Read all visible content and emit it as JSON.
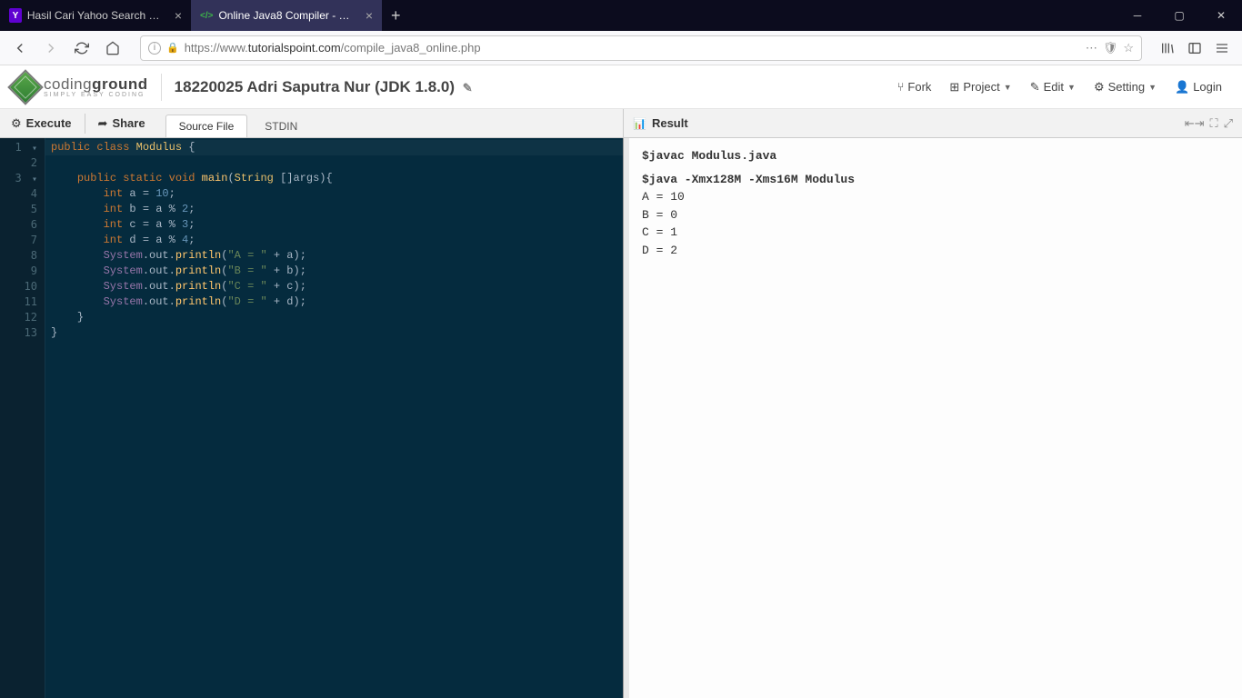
{
  "browser": {
    "tabs": [
      {
        "title": "Hasil Cari Yahoo Search Results",
        "favicon": "Y",
        "favcolor": "#5f01d1"
      },
      {
        "title": "Online Java8 Compiler - Online",
        "favicon": "</>",
        "favcolor": "#3cb44a"
      }
    ],
    "url_prefix": "https://www.",
    "url_domain": "tutorialspoint.com",
    "url_path": "/compile_java8_online.php"
  },
  "logo": {
    "main": "coding",
    "bold": "ground",
    "sub": "SIMPLY EASY CODING"
  },
  "project_title": "18220025 Adri Saputra Nur (JDK 1.8.0)",
  "header_menu": {
    "fork": "Fork",
    "project": "Project",
    "edit": "Edit",
    "setting": "Setting",
    "login": "Login"
  },
  "toolbar": {
    "execute": "Execute",
    "share": "Share",
    "source": "Source File",
    "stdin": "STDIN",
    "result": "Result"
  },
  "code_lines": [
    "public class Modulus {",
    "",
    "    public static void main(String []args){",
    "        int a = 10;",
    "        int b = a % 2;",
    "        int c = a % 3;",
    "        int d = a % 4;",
    "        System.out.println(\"A = \" + a);",
    "        System.out.println(\"B = \" + b);",
    "        System.out.println(\"C = \" + c);",
    "        System.out.println(\"D = \" + d);",
    "    }",
    "}"
  ],
  "result": {
    "cmd1": "$javac Modulus.java",
    "cmd2": "$java -Xmx128M -Xms16M Modulus",
    "out": [
      "A = 10",
      "B = 0",
      "C = 1",
      "D = 2"
    ]
  }
}
